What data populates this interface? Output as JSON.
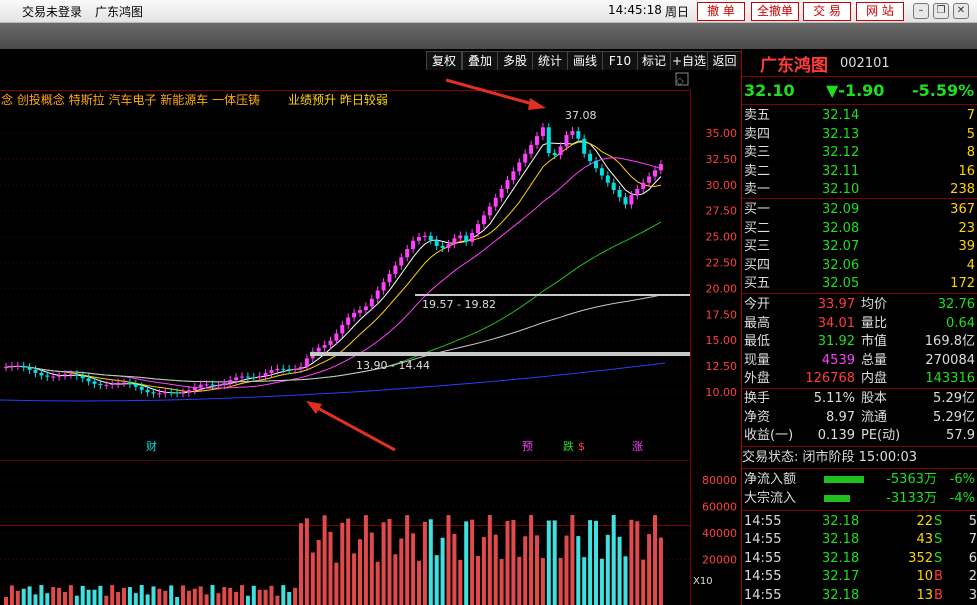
{
  "titlebar": {
    "login": "交易未登录",
    "stock": "广东鸿图",
    "time": "14:45:18",
    "weekday": "周日",
    "buttons": [
      "撤 单",
      "全撤单",
      "交 易",
      "网 站"
    ]
  },
  "toolbar": [
    "复权",
    "叠加",
    "多股",
    "统计",
    "画线",
    "F10",
    "标记",
    "+自选",
    "返回"
  ],
  "concepts": "念 创投概念 特斯拉 汽车电子 新能源车 一体压铸",
  "tag": "业绩预升 昨日较弱",
  "chart_data": {
    "type": "candlestick",
    "price_ticks": [
      "35.00",
      "32.50",
      "30.00",
      "27.50",
      "25.00",
      "22.50",
      "20.00",
      "17.50",
      "15.00",
      "12.50",
      "10.00"
    ],
    "volume_ticks": [
      "80000",
      "60000",
      "40000",
      "20000"
    ],
    "volume_unit": "X10",
    "annotations": {
      "high": "37.08",
      "range1": "19.57 - 19.82",
      "range2": "13.90 - 14.44"
    },
    "markers": [
      "财",
      "预",
      "跌",
      "$",
      "涨"
    ],
    "up_color": "#ff40ff",
    "down_color": "#00e0e0"
  },
  "quote": {
    "name": "广东鸿图",
    "code": "002101",
    "price": "32.10",
    "change": "▼-1.90",
    "pct": "-5.59%"
  },
  "asks": [
    {
      "label": "卖五",
      "price": "32.14",
      "vol": "7"
    },
    {
      "label": "卖四",
      "price": "32.13",
      "vol": "5"
    },
    {
      "label": "卖三",
      "price": "32.12",
      "vol": "8"
    },
    {
      "label": "卖二",
      "price": "32.11",
      "vol": "16"
    },
    {
      "label": "卖一",
      "price": "32.10",
      "vol": "238"
    }
  ],
  "bids": [
    {
      "label": "买一",
      "price": "32.09",
      "vol": "367"
    },
    {
      "label": "买二",
      "price": "32.08",
      "vol": "23"
    },
    {
      "label": "买三",
      "price": "32.07",
      "vol": "39"
    },
    {
      "label": "买四",
      "price": "32.06",
      "vol": "4"
    },
    {
      "label": "买五",
      "price": "32.05",
      "vol": "172"
    }
  ],
  "stats": [
    {
      "l1": "今开",
      "v1": "33.97",
      "c1": "r",
      "l2": "均价",
      "v2": "32.76",
      "c2": "g"
    },
    {
      "l1": "最高",
      "v1": "34.01",
      "c1": "r",
      "l2": "量比",
      "v2": "0.64",
      "c2": "g"
    },
    {
      "l1": "最低",
      "v1": "31.92",
      "c1": "g",
      "l2": "市值",
      "v2": "169.8亿",
      "c2": "w"
    },
    {
      "l1": "现量",
      "v1": "4539",
      "c1": "m",
      "l2": "总量",
      "v2": "270084",
      "c2": "w"
    },
    {
      "l1": "外盘",
      "v1": "126768",
      "c1": "r",
      "l2": "内盘",
      "v2": "143316",
      "c2": "g"
    }
  ],
  "stats2": [
    {
      "l1": "换手",
      "v1": "5.11%",
      "l2": "股本",
      "v2": "5.29亿"
    },
    {
      "l1": "净资",
      "v1": "8.97",
      "l2": "流通",
      "v2": "5.29亿"
    },
    {
      "l1": "收益(一)",
      "v1": "0.139",
      "l2": "PE(动)",
      "v2": "57.9"
    }
  ],
  "trade_state": "交易状态: 闭市阶段 15:00:03",
  "flows": [
    {
      "label": "净流入额",
      "value": "-5363万",
      "pct": "-6%"
    },
    {
      "label": "大宗流入",
      "value": "-3133万",
      "pct": "-4%"
    }
  ],
  "ticks": [
    {
      "time": "14:55",
      "price": "32.18",
      "vol": "22",
      "side": "S",
      "n": "5"
    },
    {
      "time": "14:55",
      "price": "32.18",
      "vol": "43",
      "side": "S",
      "n": "7"
    },
    {
      "time": "14:55",
      "price": "32.18",
      "vol": "352",
      "side": "S",
      "n": "6"
    },
    {
      "time": "14:55",
      "price": "32.17",
      "vol": "10",
      "side": "B",
      "n": "2"
    },
    {
      "time": "14:55",
      "price": "32.18",
      "vol": "13",
      "side": "B",
      "n": "3"
    }
  ]
}
